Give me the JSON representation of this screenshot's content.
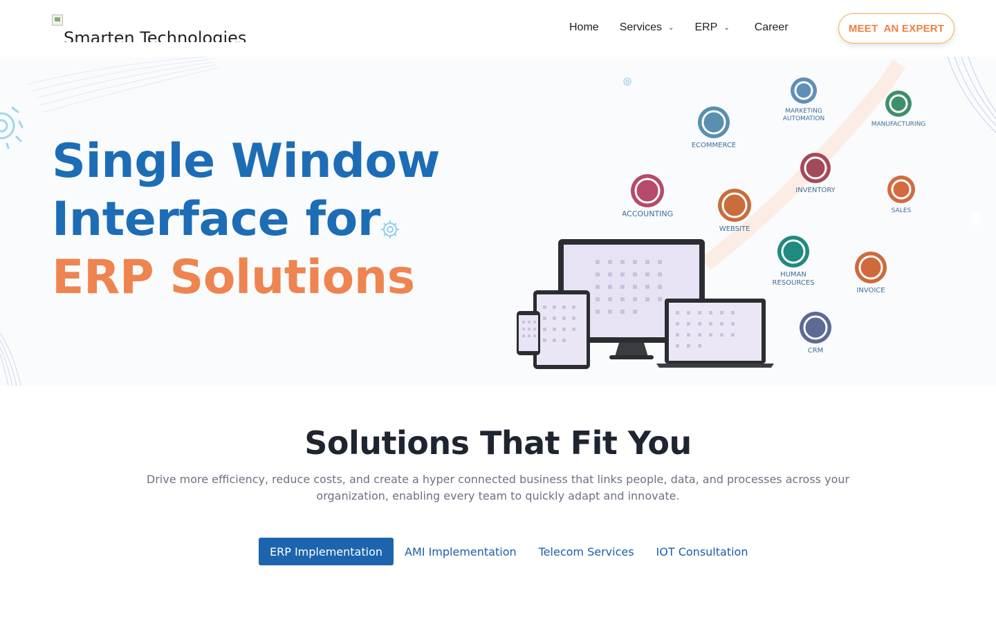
{
  "header": {
    "logo_alt": "Smarten Technologies",
    "nav": [
      {
        "label": "Home"
      },
      {
        "label": "Services"
      },
      {
        "label": "ERP"
      },
      {
        "label": "Career"
      }
    ],
    "cta_label": "MEET  AN EXPERT"
  },
  "hero": {
    "title_line1": "Single Window",
    "title_line2": "Interface for",
    "title_line3": "ERP Solutions",
    "modules": [
      {
        "label": "MARKETING\nAUTOMATION",
        "color": "#5f8fb8",
        "icon": "gear-envelope-icon"
      },
      {
        "label": "MANUFACTURING",
        "color": "#3f8f6b",
        "icon": "wrench-icon"
      },
      {
        "label": "ECOMMERCE",
        "color": "#5a8fae",
        "icon": "cart-icon"
      },
      {
        "label": "INVENTORY",
        "color": "#a34a5a",
        "icon": "box-icon"
      },
      {
        "label": "ACCOUNTING",
        "color": "#b54a6a",
        "icon": "document-gear-icon"
      },
      {
        "label": "WEBSITE",
        "color": "#c96d3d",
        "icon": "globe-icon"
      },
      {
        "label": "SALES",
        "color": "#d46a3f",
        "icon": "chart-up-icon"
      },
      {
        "label": "HUMAN\nRESOURCES",
        "color": "#1f8a80",
        "icon": "people-icon"
      },
      {
        "label": "INVOICE",
        "color": "#cf6a3c",
        "icon": "invoice-icon"
      },
      {
        "label": "CRM",
        "color": "#5d6a94",
        "icon": "handshake-icon"
      }
    ],
    "accent_blue": "#1c6db5",
    "accent_orange": "#ee8450"
  },
  "solutions": {
    "title": "Solutions That Fit You",
    "description": "Drive more efficiency, reduce costs, and create a hyper connected business that links people, data, and processes across your organization, enabling every team to quickly adapt and innovate.",
    "tabs": [
      {
        "label": "ERP Implementation",
        "active": true
      },
      {
        "label": "AMI Implementation",
        "active": false
      },
      {
        "label": "Telecom Services",
        "active": false
      },
      {
        "label": "IOT Consultation",
        "active": false
      }
    ]
  }
}
